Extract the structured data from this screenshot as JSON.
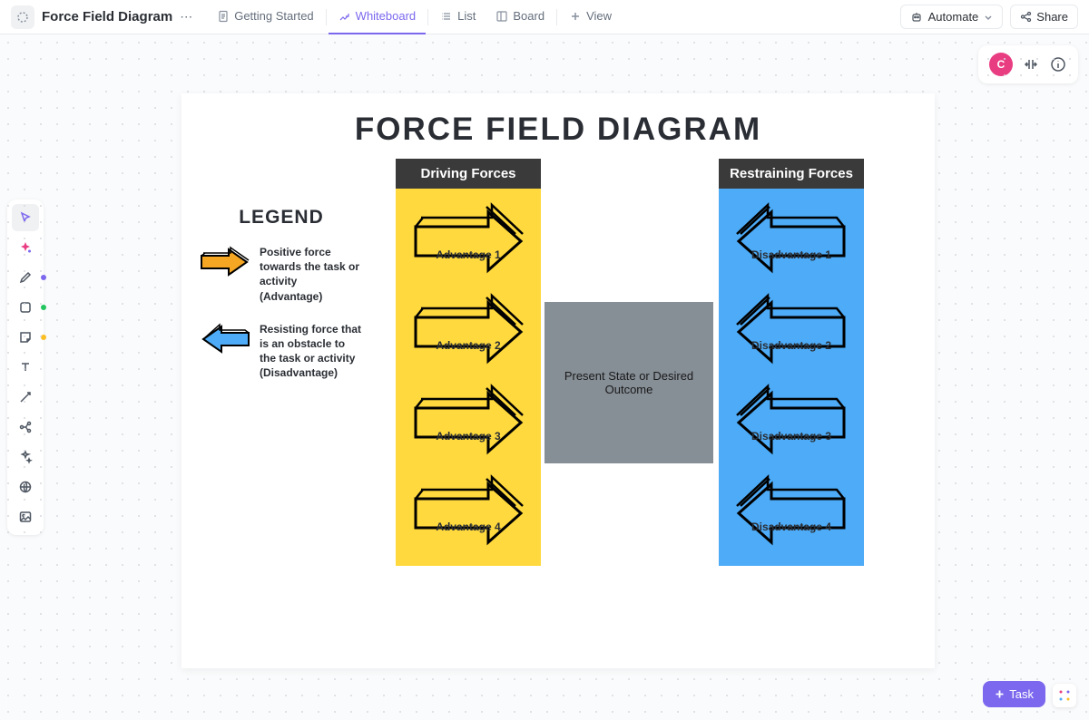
{
  "header": {
    "title": "Force Field Diagram",
    "tabs": [
      {
        "label": "Getting Started",
        "icon": "doc"
      },
      {
        "label": "Whiteboard",
        "icon": "whiteboard"
      },
      {
        "label": "List",
        "icon": "list"
      },
      {
        "label": "Board",
        "icon": "board"
      },
      {
        "label": "View",
        "icon": "plus"
      }
    ],
    "automate": "Automate",
    "share": "Share"
  },
  "avatar": "C",
  "whiteboard": {
    "title": "FORCE FIELD  DIAGRAM",
    "legend": {
      "title": "LEGEND",
      "positive": "Positive force towards the task or activity (Advantage)",
      "resisting": "Resisting force that is an obstacle to the task or activity (Disadvantage)"
    },
    "driving": {
      "header": "Driving Forces",
      "items": [
        "Advantage 1",
        "Advantage 2",
        "Advantage 3",
        "Advantage 4"
      ]
    },
    "restraining": {
      "header": "Restraining Forces",
      "items": [
        "Disadvantage 1",
        "Disadvantage 2",
        "Disadvantage 3",
        "Disadvantage 4"
      ]
    },
    "center": "Present State or Desired Outcome"
  },
  "task_button": "Task"
}
